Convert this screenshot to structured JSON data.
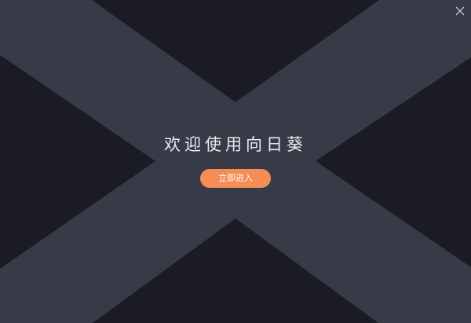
{
  "window": {
    "close_icon": "close-icon"
  },
  "welcome": {
    "title": "欢迎使用向日葵",
    "enter_label": "立即进入"
  },
  "colors": {
    "background": "#1b1b24",
    "x_shape": "#373b47",
    "accent": "#f58d55",
    "title_text": "#e9e9ee"
  }
}
